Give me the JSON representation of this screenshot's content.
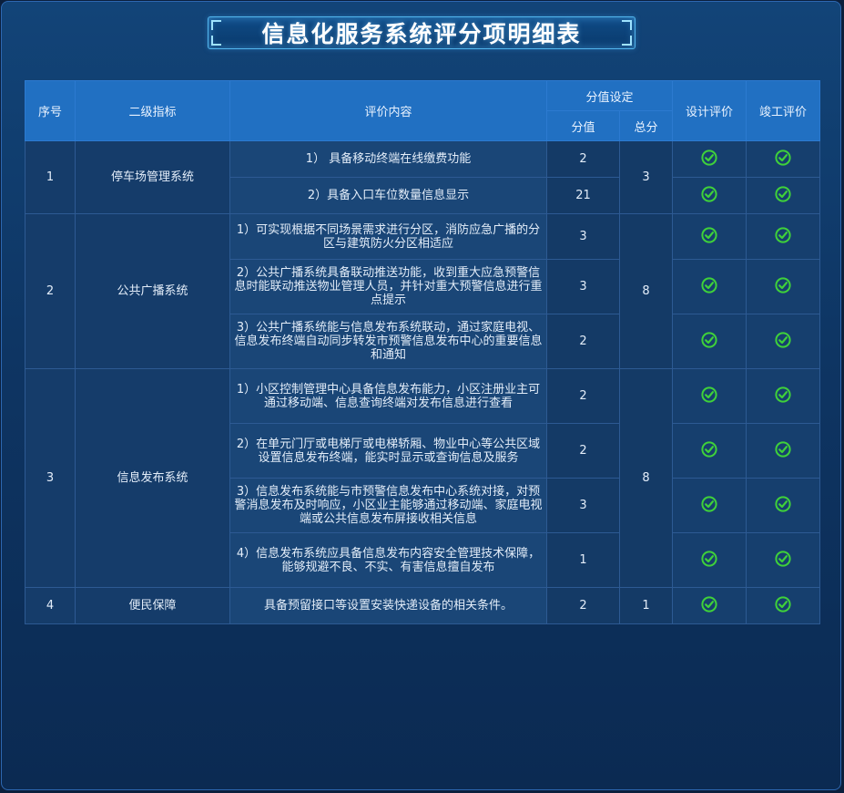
{
  "title": "信息化服务系统评分项明细表",
  "header": {
    "no": "序号",
    "indicator": "二级指标",
    "content": "评价内容",
    "score_setting": "分值设定",
    "score": "分值",
    "total": "总分",
    "design_eval": "设计评价",
    "completion_eval": "竣工评价"
  },
  "groups": [
    {
      "no": "1",
      "name": "停车场管理系统",
      "total": "3",
      "items": [
        {
          "content": "1） 具备移动终端在线缴费功能",
          "score": "2",
          "design": "check",
          "completion": "check"
        },
        {
          "content": "2）具备入口车位数量信息显示",
          "score": "21",
          "design": "check",
          "completion": "check"
        }
      ]
    },
    {
      "no": "2",
      "name": "公共广播系统",
      "total": "8",
      "items": [
        {
          "content": "1）可实现根据不同场景需求进行分区，消防应急广播的分区与建筑防火分区相适应",
          "score": "3",
          "design": "check",
          "completion": "check"
        },
        {
          "content": "2）公共广播系统具备联动推送功能，收到重大应急预警信息时能联动推送物业管理人员，并针对重大预警信息进行重点提示",
          "score": "3",
          "design": "check",
          "completion": "check"
        },
        {
          "content": "3）公共广播系统能与信息发布系统联动，通过家庭电视、信息发布终端自动同步转发市预警信息发布中心的重要信息和通知",
          "score": "2",
          "design": "check",
          "completion": "check"
        }
      ]
    },
    {
      "no": "3",
      "name": "信息发布系统",
      "total": "8",
      "items": [
        {
          "content": "1）小区控制管理中心具备信息发布能力，小区注册业主可通过移动端、信息查询终端对发布信息进行查看",
          "score": "2",
          "design": "check",
          "completion": "check"
        },
        {
          "content": "2）在单元门厅或电梯厅或电梯轿厢、物业中心等公共区域设置信息发布终端，能实时显示或查询信息及服务",
          "score": "2",
          "design": "check",
          "completion": "check"
        },
        {
          "content": "3）信息发布系统能与市预警信息发布中心系统对接，对预警消息发布及时响应，小区业主能够通过移动端、家庭电视端或公共信息发布屏接收相关信息",
          "score": "3",
          "design": "check",
          "completion": "check"
        },
        {
          "content": "4）信息发布系统应具备信息发布内容安全管理技术保障，能够规避不良、不实、有害信息擅自发布",
          "score": "1",
          "design": "check",
          "completion": "check"
        }
      ]
    },
    {
      "no": "4",
      "name": "便民保障",
      "total": "1",
      "items": [
        {
          "content": "具备预留接口等设置安装快递设备的相关条件。",
          "score": "2",
          "design": "check",
          "completion": "check"
        }
      ]
    }
  ],
  "colors": {
    "check": "#3fd13a",
    "header_bg": "#2170c2",
    "panel_bg": "#0e3563"
  }
}
